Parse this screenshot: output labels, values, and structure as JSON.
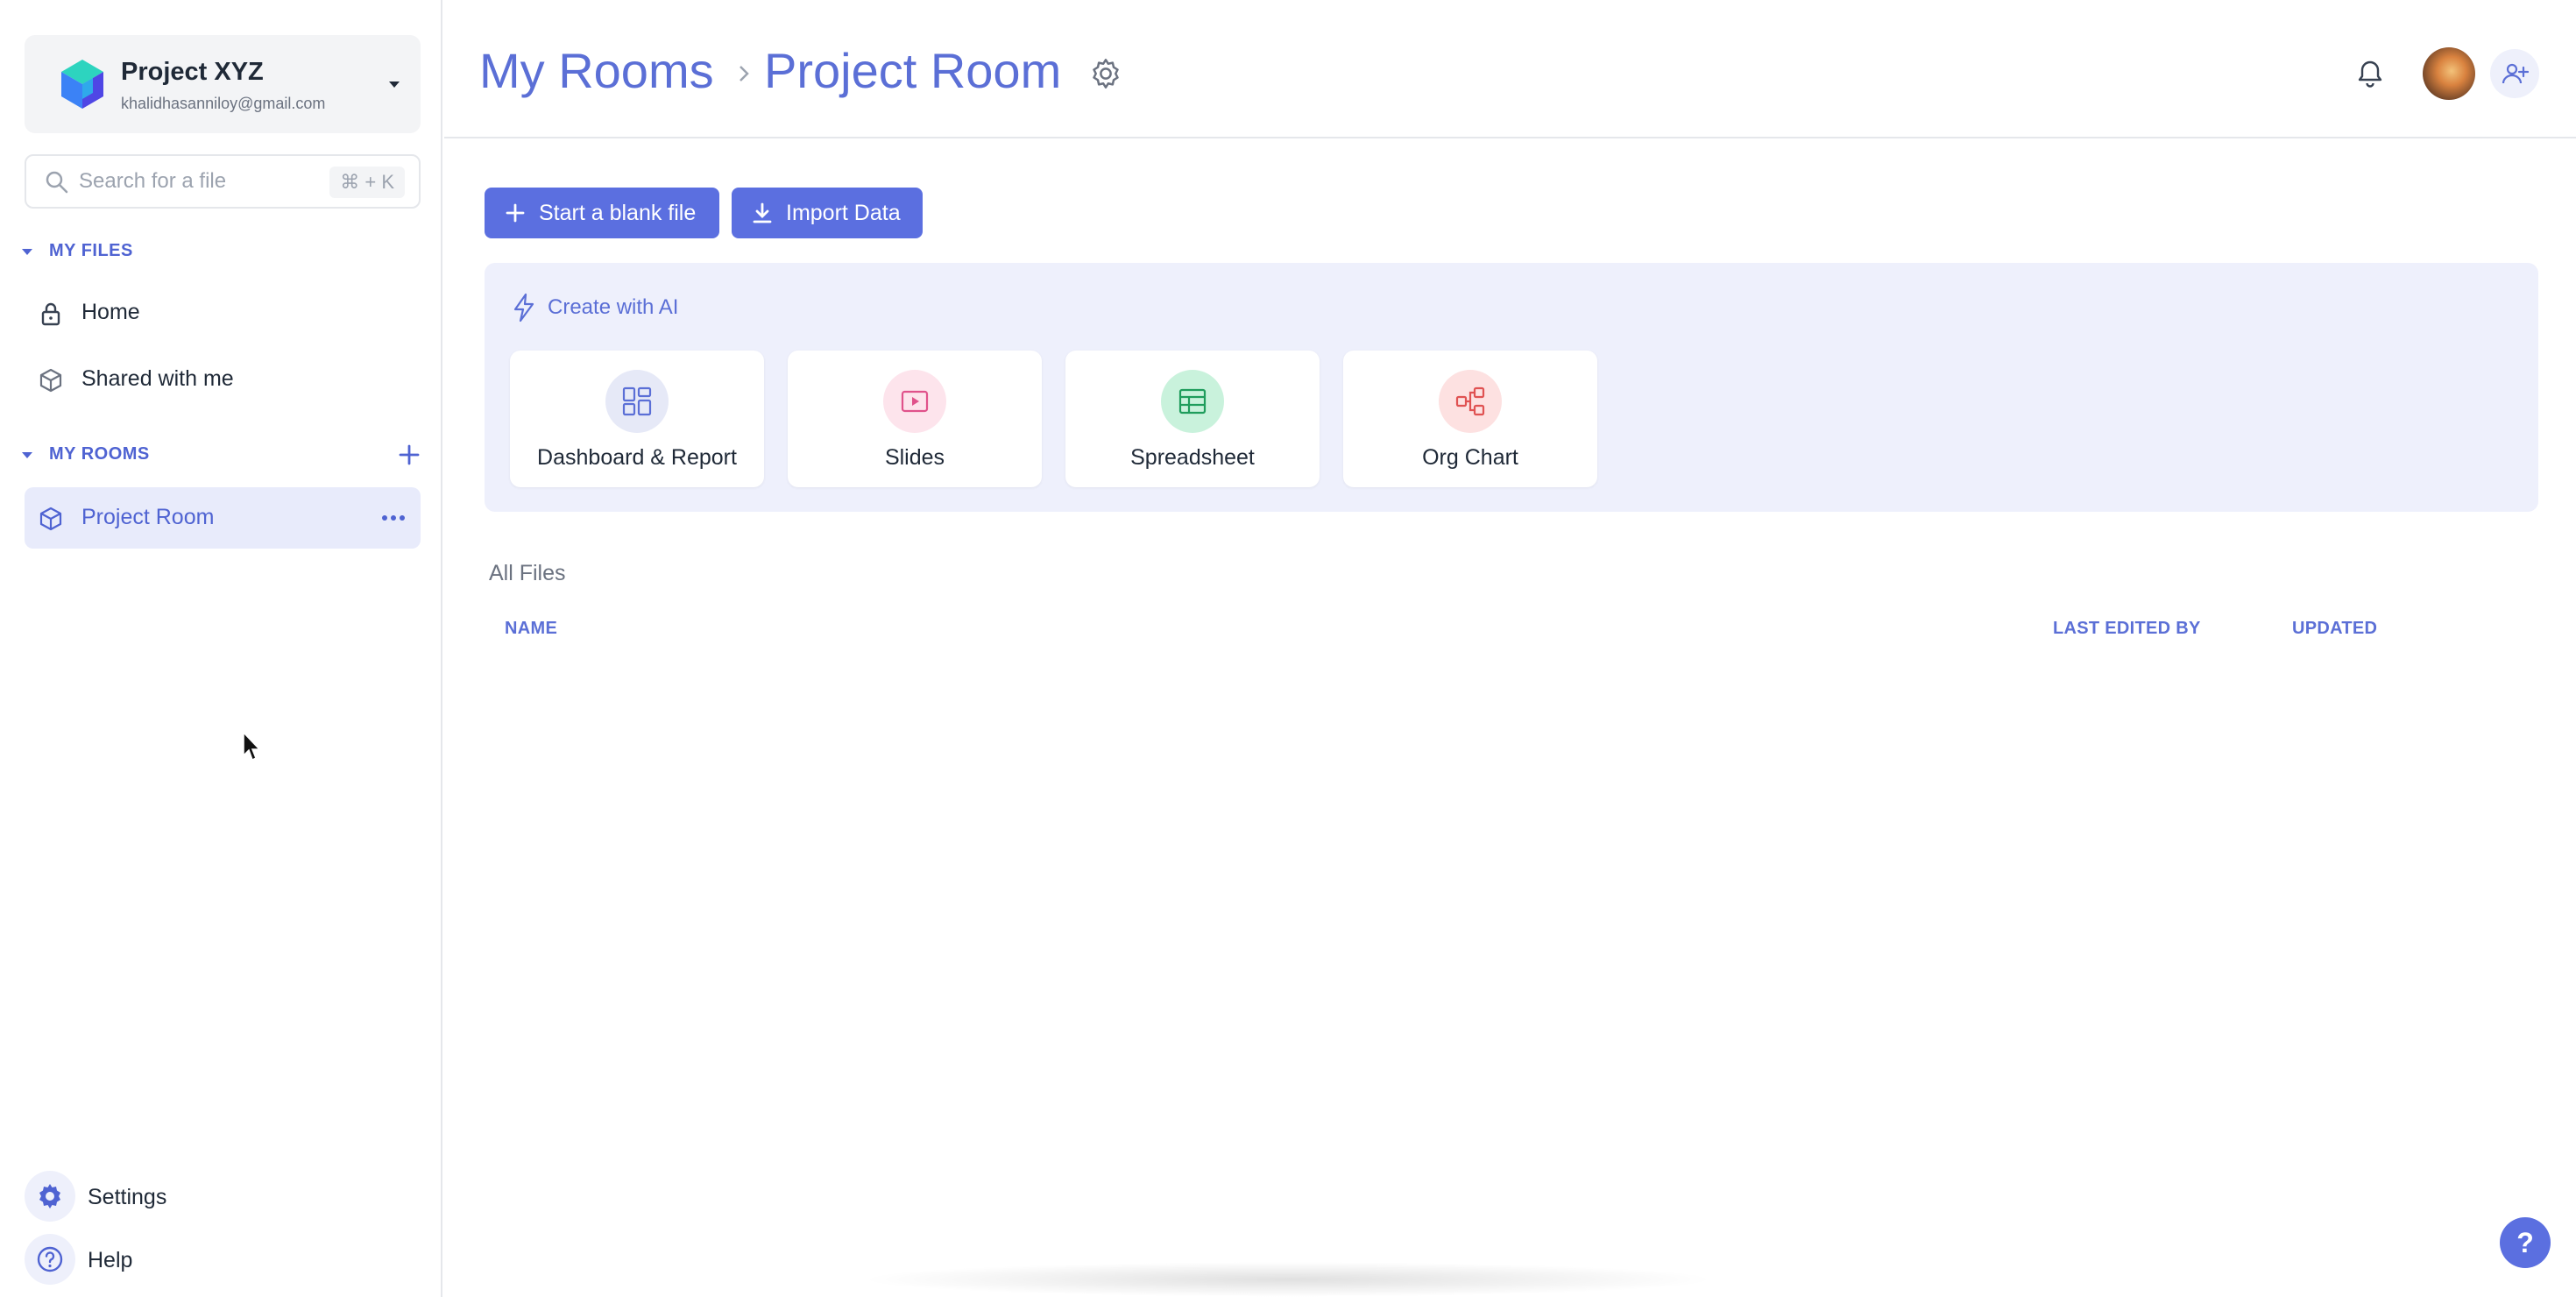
{
  "workspace": {
    "name": "Project XYZ",
    "email": "khalidhasanniloy@gmail.com"
  },
  "search": {
    "placeholder": "Search for a file",
    "shortcut": "⌘ + K"
  },
  "sidebar": {
    "my_files_label": "MY FILES",
    "my_files_items": [
      {
        "label": "Home",
        "icon": "lock-icon"
      },
      {
        "label": "Shared with me",
        "icon": "cube-icon"
      }
    ],
    "my_rooms_label": "MY ROOMS",
    "rooms": [
      {
        "label": "Project Room",
        "icon": "cube-icon",
        "active": true
      }
    ],
    "settings_label": "Settings",
    "help_label": "Help"
  },
  "breadcrumb": {
    "root": "My Rooms",
    "current": "Project Room"
  },
  "actions": {
    "blank_file_label": "Start a blank file",
    "import_label": "Import Data"
  },
  "ai": {
    "title": "Create with AI",
    "cards": [
      {
        "label": "Dashboard & Report",
        "icon": "dashboard-icon",
        "bg": "#e6e9f7",
        "fg": "#5b6fd6"
      },
      {
        "label": "Slides",
        "icon": "slides-icon",
        "bg": "#fde4ec",
        "fg": "#e0528b"
      },
      {
        "label": "Spreadsheet",
        "icon": "spreadsheet-icon",
        "bg": "#c9f2dc",
        "fg": "#1f9d5c"
      },
      {
        "label": "Org Chart",
        "icon": "org-chart-icon",
        "bg": "#fde1e1",
        "fg": "#e05252"
      }
    ]
  },
  "files": {
    "title": "All Files",
    "columns": [
      "NAME",
      "LAST EDITED BY",
      "UPDATED"
    ]
  },
  "colors": {
    "accent": "#5b6fe0",
    "accent_text": "#5b6fd6",
    "active_bg": "#e8ebfb"
  },
  "help_fab_label": "?"
}
